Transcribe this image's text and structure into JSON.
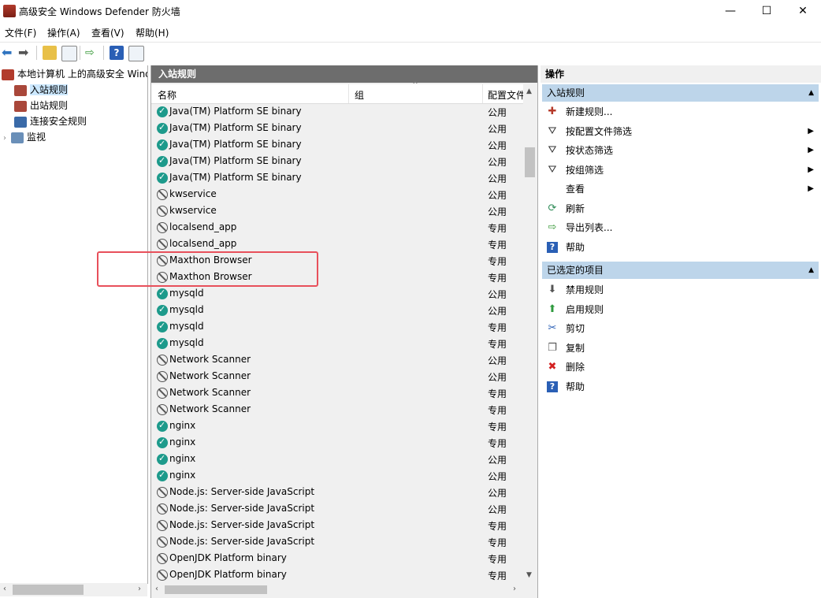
{
  "window": {
    "title": "高级安全 Windows Defender 防火墙",
    "minimize": "—",
    "maximize": "☐",
    "close": "✕"
  },
  "menu": [
    "文件(F)",
    "操作(A)",
    "查看(V)",
    "帮助(H)"
  ],
  "tree": {
    "root": "本地计算机 上的高级安全 Windows Defender 防火墙",
    "items": [
      "入站规则",
      "出站规则",
      "连接安全规则",
      "监视"
    ]
  },
  "center": {
    "header": "入站规则",
    "columns": [
      "名称",
      "组",
      "配置文件"
    ],
    "rows": [
      {
        "name": "Java(TM) Platform SE binary",
        "profile": "公用",
        "enabled": true
      },
      {
        "name": "Java(TM) Platform SE binary",
        "profile": "公用",
        "enabled": true
      },
      {
        "name": "Java(TM) Platform SE binary",
        "profile": "公用",
        "enabled": true
      },
      {
        "name": "Java(TM) Platform SE binary",
        "profile": "公用",
        "enabled": true
      },
      {
        "name": "Java(TM) Platform SE binary",
        "profile": "公用",
        "enabled": true
      },
      {
        "name": "kwservice",
        "profile": "公用",
        "enabled": false
      },
      {
        "name": "kwservice",
        "profile": "公用",
        "enabled": false
      },
      {
        "name": "localsend_app",
        "profile": "专用",
        "enabled": false
      },
      {
        "name": "localsend_app",
        "profile": "专用",
        "enabled": false
      },
      {
        "name": "Maxthon Browser",
        "profile": "专用",
        "enabled": false
      },
      {
        "name": "Maxthon Browser",
        "profile": "专用",
        "enabled": false
      },
      {
        "name": "mysqld",
        "profile": "公用",
        "enabled": true
      },
      {
        "name": "mysqld",
        "profile": "公用",
        "enabled": true
      },
      {
        "name": "mysqld",
        "profile": "专用",
        "enabled": true
      },
      {
        "name": "mysqld",
        "profile": "专用",
        "enabled": true
      },
      {
        "name": "Network Scanner",
        "profile": "公用",
        "enabled": false
      },
      {
        "name": "Network Scanner",
        "profile": "公用",
        "enabled": false
      },
      {
        "name": "Network Scanner",
        "profile": "专用",
        "enabled": false
      },
      {
        "name": "Network Scanner",
        "profile": "专用",
        "enabled": false
      },
      {
        "name": "nginx",
        "profile": "专用",
        "enabled": true
      },
      {
        "name": "nginx",
        "profile": "专用",
        "enabled": true
      },
      {
        "name": "nginx",
        "profile": "公用",
        "enabled": true
      },
      {
        "name": "nginx",
        "profile": "公用",
        "enabled": true
      },
      {
        "name": "Node.js: Server-side JavaScript",
        "profile": "公用",
        "enabled": false
      },
      {
        "name": "Node.js: Server-side JavaScript",
        "profile": "公用",
        "enabled": false
      },
      {
        "name": "Node.js: Server-side JavaScript",
        "profile": "专用",
        "enabled": false
      },
      {
        "name": "Node.js: Server-side JavaScript",
        "profile": "专用",
        "enabled": false
      },
      {
        "name": "OpenJDK Platform binary",
        "profile": "专用",
        "enabled": false
      },
      {
        "name": "OpenJDK Platform binary",
        "profile": "专用",
        "enabled": false
      }
    ]
  },
  "actions": {
    "title": "操作",
    "section1": {
      "label": "入站规则",
      "items": [
        {
          "label": "新建规则...",
          "icon": "new-rule-icon",
          "submenu": false
        },
        {
          "label": "按配置文件筛选",
          "icon": "filter-icon",
          "submenu": true
        },
        {
          "label": "按状态筛选",
          "icon": "filter-icon",
          "submenu": true
        },
        {
          "label": "按组筛选",
          "icon": "filter-icon",
          "submenu": true
        },
        {
          "label": "查看",
          "icon": "",
          "submenu": true
        },
        {
          "label": "刷新",
          "icon": "refresh-icon",
          "submenu": false
        },
        {
          "label": "导出列表...",
          "icon": "export-icon",
          "submenu": false
        },
        {
          "label": "帮助",
          "icon": "help-icon",
          "submenu": false
        }
      ]
    },
    "section2": {
      "label": "已选定的项目",
      "items": [
        {
          "label": "禁用规则",
          "icon": "disable-icon"
        },
        {
          "label": "启用规则",
          "icon": "enable-icon"
        },
        {
          "label": "剪切",
          "icon": "cut-icon"
        },
        {
          "label": "复制",
          "icon": "copy-icon"
        },
        {
          "label": "删除",
          "icon": "delete-icon"
        },
        {
          "label": "帮助",
          "icon": "help-icon"
        }
      ]
    }
  },
  "colors": {
    "highlight_box": "#e8505b",
    "enabled_rule": "#1d9a8b",
    "section_header": "#bdd5ea",
    "panel_header": "#6d6d6d"
  }
}
